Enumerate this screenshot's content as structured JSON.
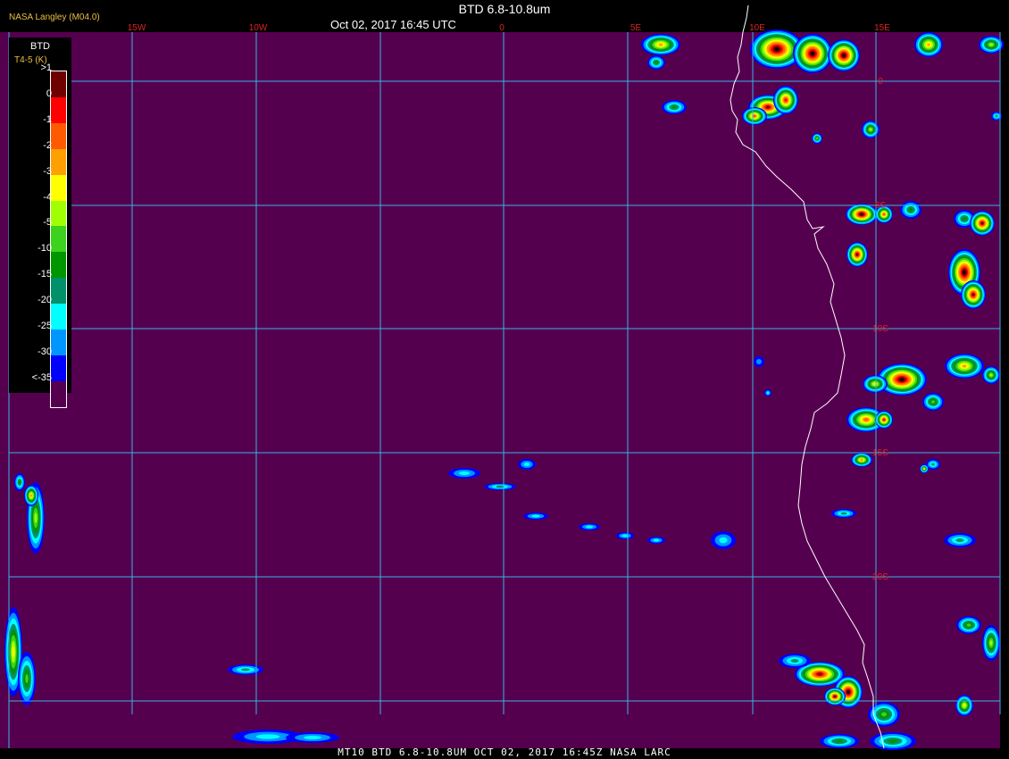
{
  "header": {
    "title": "BTD 6.8-10.8um",
    "datetime": "Oct 02, 2017 16:45 UTC",
    "credit": "NASA Langley (M04.0)"
  },
  "footer": {
    "caption": "MT10  BTD 6.8-10.8UM  OCT 02, 2017 16:45Z  NASA LARC"
  },
  "legend": {
    "title": "BTD",
    "subtitle": "T4-5 (K)",
    "labels": [
      ">1",
      "0",
      "-1",
      "-2",
      "-3",
      "-4",
      "-5",
      "-10",
      "-15",
      "-20",
      "-25",
      "-30",
      "<-35"
    ],
    "colors": [
      "#6e0000",
      "#ff0000",
      "#ff5a00",
      "#ffa000",
      "#ffff00",
      "#a0ff00",
      "#3cd21e",
      "#009600",
      "#00906a",
      "#00ffff",
      "#0096ff",
      "#0000ff",
      "#55004f"
    ]
  },
  "map": {
    "background": "#55004f",
    "grid_color": "#36b4e6",
    "lon_labels": [
      "15W",
      "10W",
      "0",
      "5E",
      "10E",
      "15E"
    ],
    "lat_labels": [
      "0",
      "5S",
      "10S",
      "15S",
      "20S"
    ],
    "lon_label_color": "#e02020",
    "lat_label_color": "#e02020",
    "coast_color": "#ffffff"
  }
}
